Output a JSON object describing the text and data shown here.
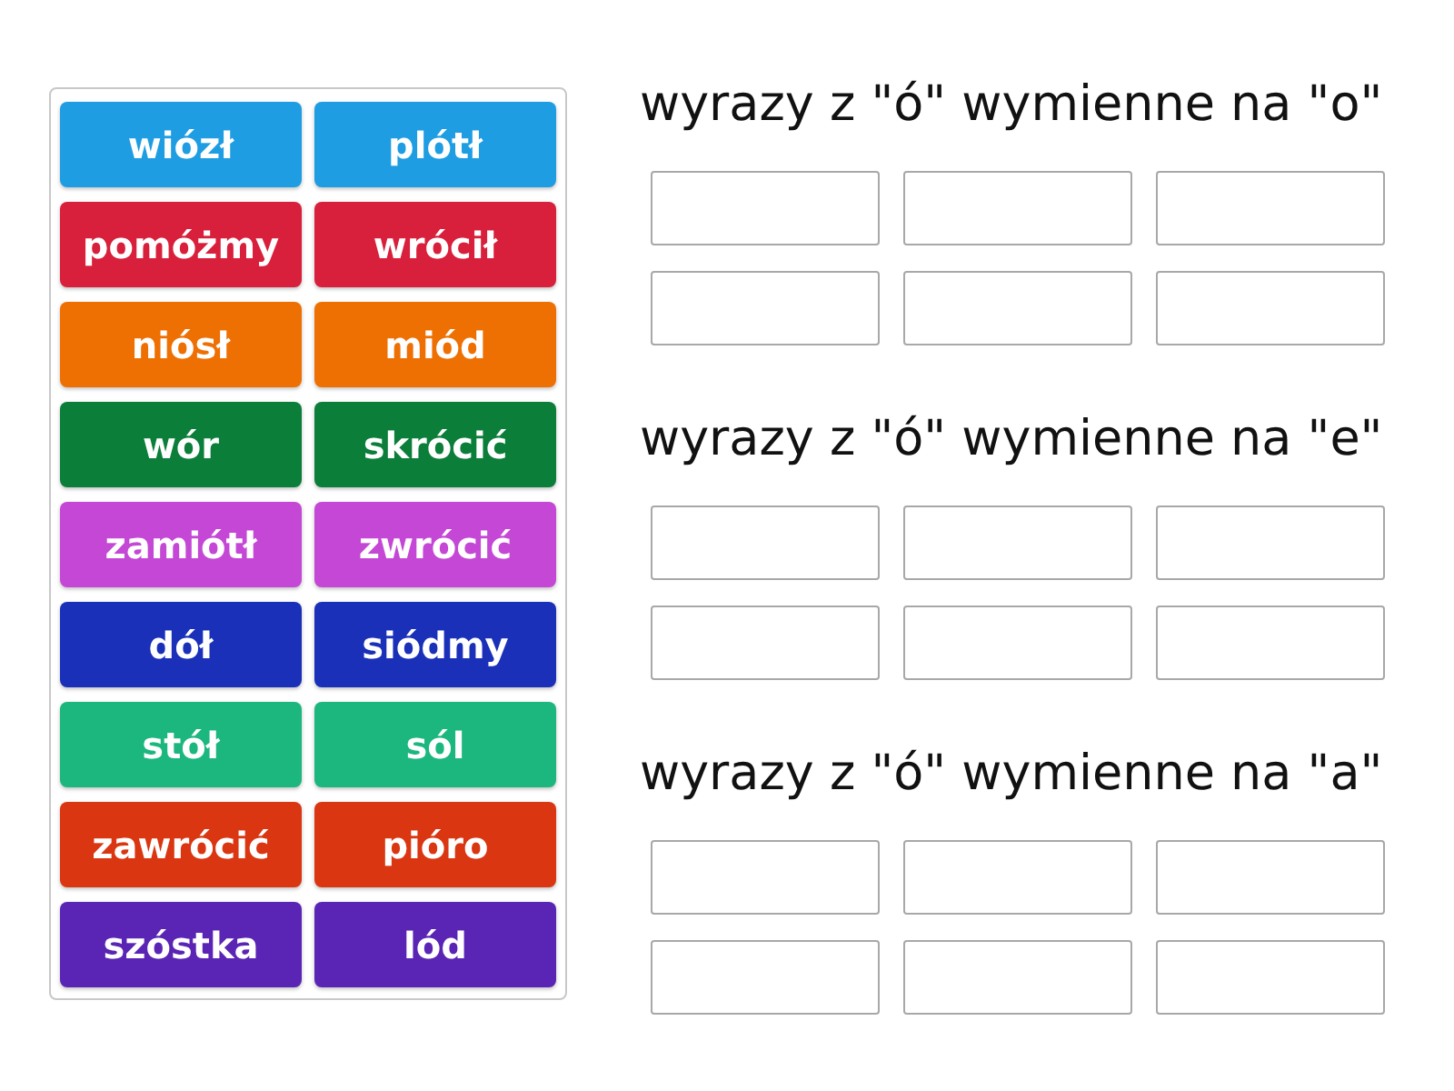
{
  "tiles": [
    {
      "label": "wiózł",
      "color": "#1f9de2"
    },
    {
      "label": "plótł",
      "color": "#1f9de2"
    },
    {
      "label": "pomóżmy",
      "color": "#d81f3b"
    },
    {
      "label": "wrócił",
      "color": "#d81f3b"
    },
    {
      "label": "niósł",
      "color": "#ee7003"
    },
    {
      "label": "miód",
      "color": "#ee7003"
    },
    {
      "label": "wór",
      "color": "#0b7e3a"
    },
    {
      "label": "skrócić",
      "color": "#0b7e3a"
    },
    {
      "label": "zamiótł",
      "color": "#c448d5"
    },
    {
      "label": "zwrócić",
      "color": "#c448d5"
    },
    {
      "label": "dół",
      "color": "#1a30b8"
    },
    {
      "label": "siódmy",
      "color": "#1a30b8"
    },
    {
      "label": "stół",
      "color": "#1cb77e"
    },
    {
      "label": "sól",
      "color": "#1cb77e"
    },
    {
      "label": "zawrócić",
      "color": "#d93611"
    },
    {
      "label": "pióro",
      "color": "#d93611"
    },
    {
      "label": "szóstka",
      "color": "#5a25b4"
    },
    {
      "label": "lód",
      "color": "#5a25b4"
    }
  ],
  "groups": [
    {
      "heading": "wyrazy z \"ó\" wymienne na \"o\"",
      "boxes": [
        {
          "kind": "empty"
        },
        {
          "kind": "empty"
        },
        {
          "kind": "empty"
        },
        {
          "kind": "empty"
        },
        {
          "kind": "empty"
        },
        {
          "kind": "empty"
        }
      ]
    },
    {
      "heading": "wyrazy z \"ó\" wymienne na \"e\"",
      "boxes": [
        {
          "kind": "empty"
        },
        {
          "kind": "empty"
        },
        {
          "kind": "empty"
        },
        {
          "kind": "empty"
        },
        {
          "kind": "empty"
        },
        {
          "kind": "empty"
        }
      ]
    },
    {
      "heading": "wyrazy z \"ó\" wymienne na \"a\"",
      "boxes": [
        {
          "kind": "empty"
        },
        {
          "kind": "empty"
        },
        {
          "kind": "empty"
        },
        {
          "kind": "empty"
        },
        {
          "kind": "empty"
        },
        {
          "kind": "empty"
        }
      ]
    }
  ]
}
